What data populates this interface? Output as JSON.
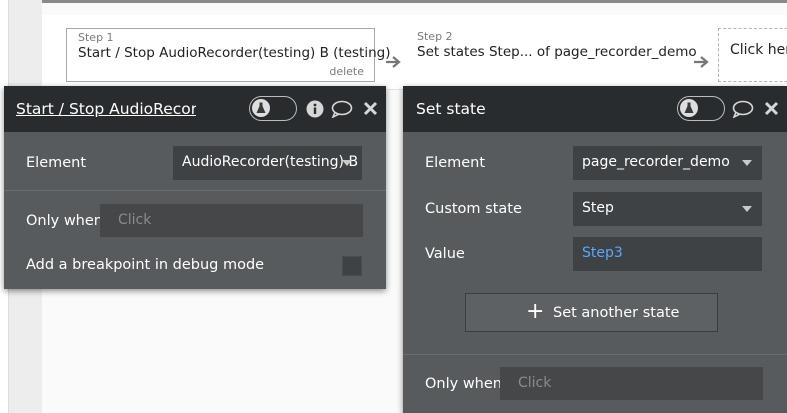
{
  "workflow": {
    "steps": [
      {
        "number": "Step 1",
        "title": "Start / Stop AudioRecorder(testing) B (testing)",
        "delete_label": "delete"
      },
      {
        "number": "Step 2",
        "title": "Set states Step... of page_recorder_demo"
      },
      {
        "title": "Click here"
      }
    ]
  },
  "left_panel": {
    "title": "Start / Stop AudioRecorder(testing) B (testing)",
    "element_label": "Element",
    "element_value": "AudioRecorder(testing) B",
    "only_when_label": "Only when",
    "only_when_placeholder": "Click",
    "breakpoint_label": "Add a breakpoint in debug mode"
  },
  "right_panel": {
    "title": "Set state",
    "element_label": "Element",
    "element_value": "page_recorder_demo",
    "custom_state_label": "Custom state",
    "custom_state_value": "Step",
    "value_label": "Value",
    "value_value": "Step3",
    "set_another_label": "Set another state",
    "only_when_label": "Only when",
    "only_when_placeholder": "Click"
  },
  "icons": {
    "flask": "flask-icon",
    "info": "info-icon",
    "comment": "comment-icon",
    "close": "close-icon",
    "arrow": "arrow-right-icon",
    "plus": "plus-icon",
    "caret": "chevron-down-icon"
  },
  "colors": {
    "panel_bg": "#585b5d",
    "panel_header": "#292c2e",
    "input_bg": "#3f4244",
    "dynamic_value": "#5aa7ff"
  }
}
